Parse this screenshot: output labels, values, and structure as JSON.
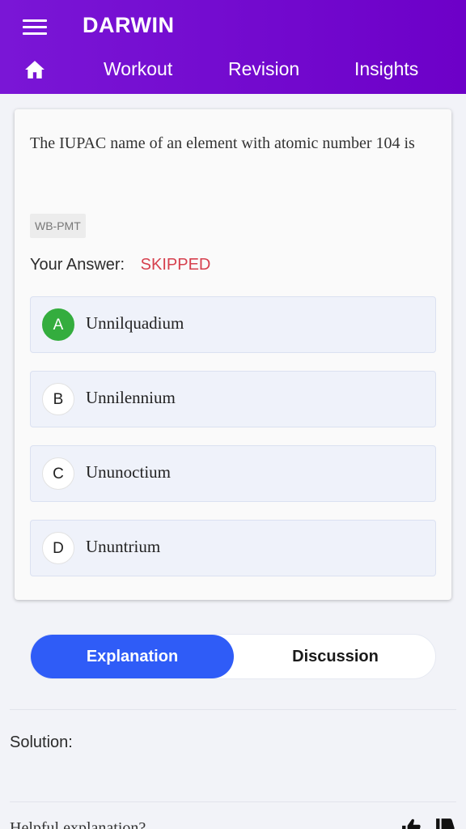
{
  "app": {
    "title": "DARWIN"
  },
  "nav": {
    "items": [
      "Workout",
      "Revision",
      "Insights"
    ]
  },
  "question": {
    "text": "The IUPAC name of an element with atomic number 104 is",
    "tag": "WB-PMT",
    "answer_label": "Your Answer:",
    "answer_value": "SKIPPED",
    "status_color": "#d6404e",
    "correct_color": "#34ad3e",
    "options": [
      {
        "letter": "A",
        "text": "Unnilquadium",
        "correct": true
      },
      {
        "letter": "B",
        "text": "Unnilennium",
        "correct": false
      },
      {
        "letter": "C",
        "text": "Ununoctium",
        "correct": false
      },
      {
        "letter": "D",
        "text": "Ununtrium",
        "correct": false
      }
    ]
  },
  "tabs": {
    "explanation": "Explanation",
    "discussion": "Discussion",
    "active": "Explanation",
    "active_color": "#2f5cf7"
  },
  "solution": {
    "label": "Solution:"
  },
  "feedback": {
    "prompt": "Helpful explanation?",
    "icons": [
      "thumbs-up-icon",
      "thumbs-down-icon"
    ]
  },
  "colors": {
    "header": "#7a16d6"
  }
}
